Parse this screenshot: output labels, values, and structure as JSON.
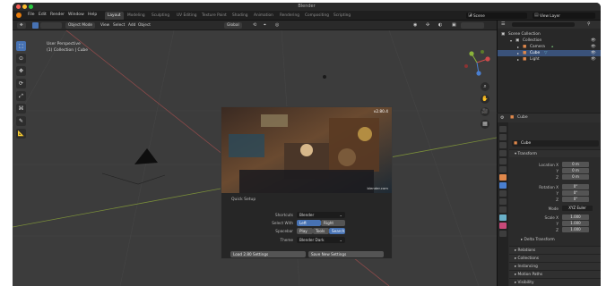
{
  "window": {
    "title": "Blender"
  },
  "menubar": {
    "items": [
      "File",
      "Edit",
      "Render",
      "Window",
      "Help"
    ],
    "workspaces": [
      "Layout",
      "Modeling",
      "Sculpting",
      "UV Editing",
      "Texture Paint",
      "Shading",
      "Animation",
      "Rendering",
      "Compositing",
      "Scripting"
    ],
    "active_workspace": "Layout",
    "scene": "Scene",
    "view_layer": "View Layer"
  },
  "toolbar": {
    "mode": "Object Mode",
    "menus": [
      "View",
      "Select",
      "Add",
      "Object"
    ],
    "orientation": "Global",
    "options": "Options"
  },
  "viewport": {
    "perspective": "User Perspective",
    "collection_info": "(1) Collection | Cube"
  },
  "splash": {
    "version": "v2.80.4",
    "watermark": "blender.com",
    "heading": "Quick Setup",
    "shortcuts_label": "Shortcuts",
    "shortcuts_value": "Blender",
    "select_with_label": "Select With",
    "select_with_options": [
      "Left",
      "Right"
    ],
    "select_with_active": "Left",
    "spacebar_label": "Spacebar",
    "spacebar_options": [
      "Play",
      "Tools",
      "Search"
    ],
    "spacebar_active": "Search",
    "theme_label": "Theme",
    "theme_value": "Blender Dark",
    "load_button": "Load 2.80 Settings",
    "save_button": "Save New Settings"
  },
  "outliner": {
    "root": "Scene Collection",
    "items": [
      {
        "label": "Collection",
        "color": "#8b8b8b",
        "selected": false
      },
      {
        "label": "Camera",
        "color": "#e0884b",
        "selected": false
      },
      {
        "label": "Cube",
        "color": "#e0884b",
        "selected": true
      },
      {
        "label": "Light",
        "color": "#e0884b",
        "selected": false
      }
    ]
  },
  "properties": {
    "object_name_header": "Cube",
    "object_name": "Cube",
    "transform_header": "Transform",
    "location_label": "Location X",
    "location": [
      "0 m",
      "0 m",
      "0 m"
    ],
    "rotation_label": "Rotation X",
    "rotation": [
      "0°",
      "0°",
      "0°"
    ],
    "mode_label": "Mode",
    "mode_value": "XYZ Euler",
    "scale_label": "Scale X",
    "scale": [
      "1.000",
      "1.000",
      "1.000"
    ],
    "axis_y": "Y",
    "axis_z": "Z",
    "delta_transform": "Delta Transform",
    "sections": [
      "Relations",
      "Collections",
      "Instancing",
      "Motion Paths",
      "Visibility"
    ]
  },
  "colors": {
    "accent": "#4772b3",
    "bg_window": "#1d1d1d",
    "bg_viewport": "#3c3c3c",
    "selection": "#3a527a"
  }
}
